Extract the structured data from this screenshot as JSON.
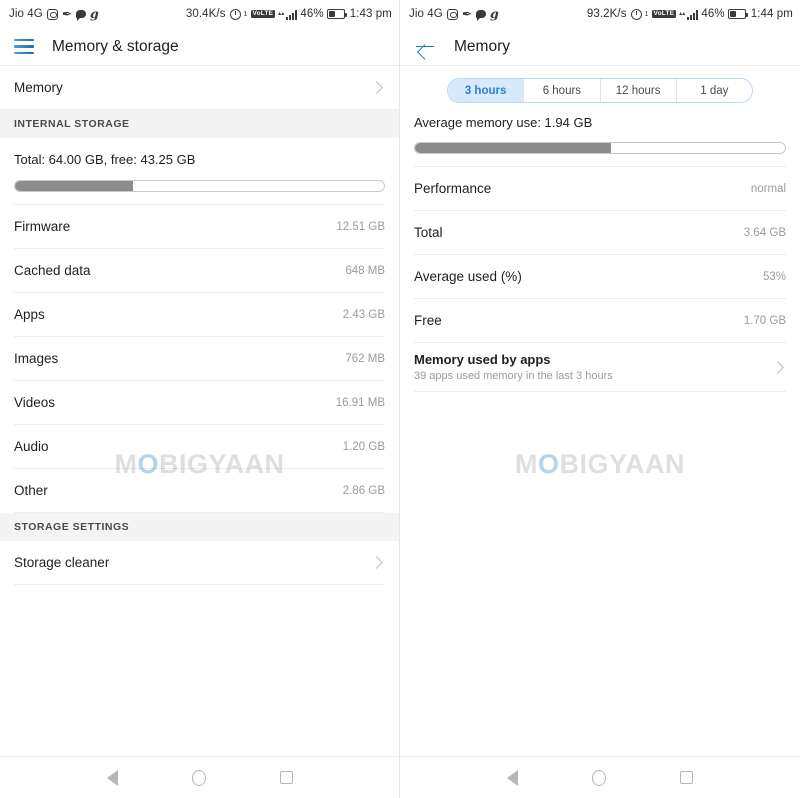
{
  "left": {
    "statusbar": {
      "carrier": "Jio 4G",
      "icons_left": [
        "camera-icon",
        "pen-icon",
        "chat-bubble-icon",
        "g-icon"
      ],
      "net_speed": "30.4K/s",
      "alarm_icon": "alarm-icon",
      "alarm_sup": "1",
      "volte_label": "VoLTE",
      "signal_icon": "signal-bars-icon",
      "battery_pct": "46%",
      "battery_icon": "battery-icon",
      "clock": "1:43 pm"
    },
    "appbar": {
      "menu_icon": "hamburger-menu-icon",
      "title": "Memory & storage"
    },
    "memory_row": {
      "label": "Memory",
      "chevron": "chevron-right-icon"
    },
    "section_internal": "INTERNAL STORAGE",
    "storage": {
      "summary": "Total: 64.00 GB, free: 43.25 GB",
      "used_percent": 32,
      "bar_fill_color": "#8c8c8c"
    },
    "items": [
      {
        "label": "Firmware",
        "value": "12.51 GB"
      },
      {
        "label": "Cached data",
        "value": "648 MB"
      },
      {
        "label": "Apps",
        "value": "2.43 GB"
      },
      {
        "label": "Images",
        "value": "762 MB"
      },
      {
        "label": "Videos",
        "value": "16.91 MB"
      },
      {
        "label": "Audio",
        "value": "1.20 GB"
      },
      {
        "label": "Other",
        "value": "2.86 GB"
      }
    ],
    "section_settings": "STORAGE SETTINGS",
    "cleaner_row": {
      "label": "Storage cleaner",
      "chevron": "chevron-right-icon"
    }
  },
  "right": {
    "statusbar": {
      "carrier": "Jio 4G",
      "icons_left": [
        "camera-icon",
        "pen-icon",
        "chat-bubble-icon",
        "g-icon"
      ],
      "net_speed": "93.2K/s",
      "alarm_icon": "alarm-icon",
      "alarm_sup": "1",
      "volte_label": "VoLTE",
      "signal_icon": "signal-bars-icon",
      "battery_pct": "46%",
      "battery_icon": "battery-icon",
      "clock": "1:44 pm"
    },
    "appbar": {
      "back_icon": "back-arrow-icon",
      "title": "Memory"
    },
    "tabs": [
      {
        "label": "3 hours",
        "active": true
      },
      {
        "label": "6 hours",
        "active": false
      },
      {
        "label": "12 hours",
        "active": false
      },
      {
        "label": "1 day",
        "active": false
      }
    ],
    "average": {
      "label": "Average memory use: 1.94 GB",
      "used_percent": 53,
      "bar_fill_color": "#8c8c8c"
    },
    "items": [
      {
        "label": "Performance",
        "value": "normal"
      },
      {
        "label": "Total",
        "value": "3.64 GB"
      },
      {
        "label": "Average used (%)",
        "value": "53%"
      },
      {
        "label": "Free",
        "value": "1.70 GB"
      }
    ],
    "apps_row": {
      "label": "Memory used by apps",
      "sub": "39 apps used memory in the last 3 hours",
      "chevron": "chevron-right-icon"
    }
  },
  "navbar": {
    "back": "nav-back-icon",
    "home": "nav-home-icon",
    "recents": "nav-recents-icon"
  },
  "watermark": {
    "pre": "M",
    "o": "O",
    "post": "BIGYAAN"
  },
  "colors": {
    "accent_blue": "#2477c4",
    "tab_active_bg": "#d6eafc",
    "tab_active_text": "#2b7fd4",
    "bar_fill": "#8c8c8c"
  }
}
